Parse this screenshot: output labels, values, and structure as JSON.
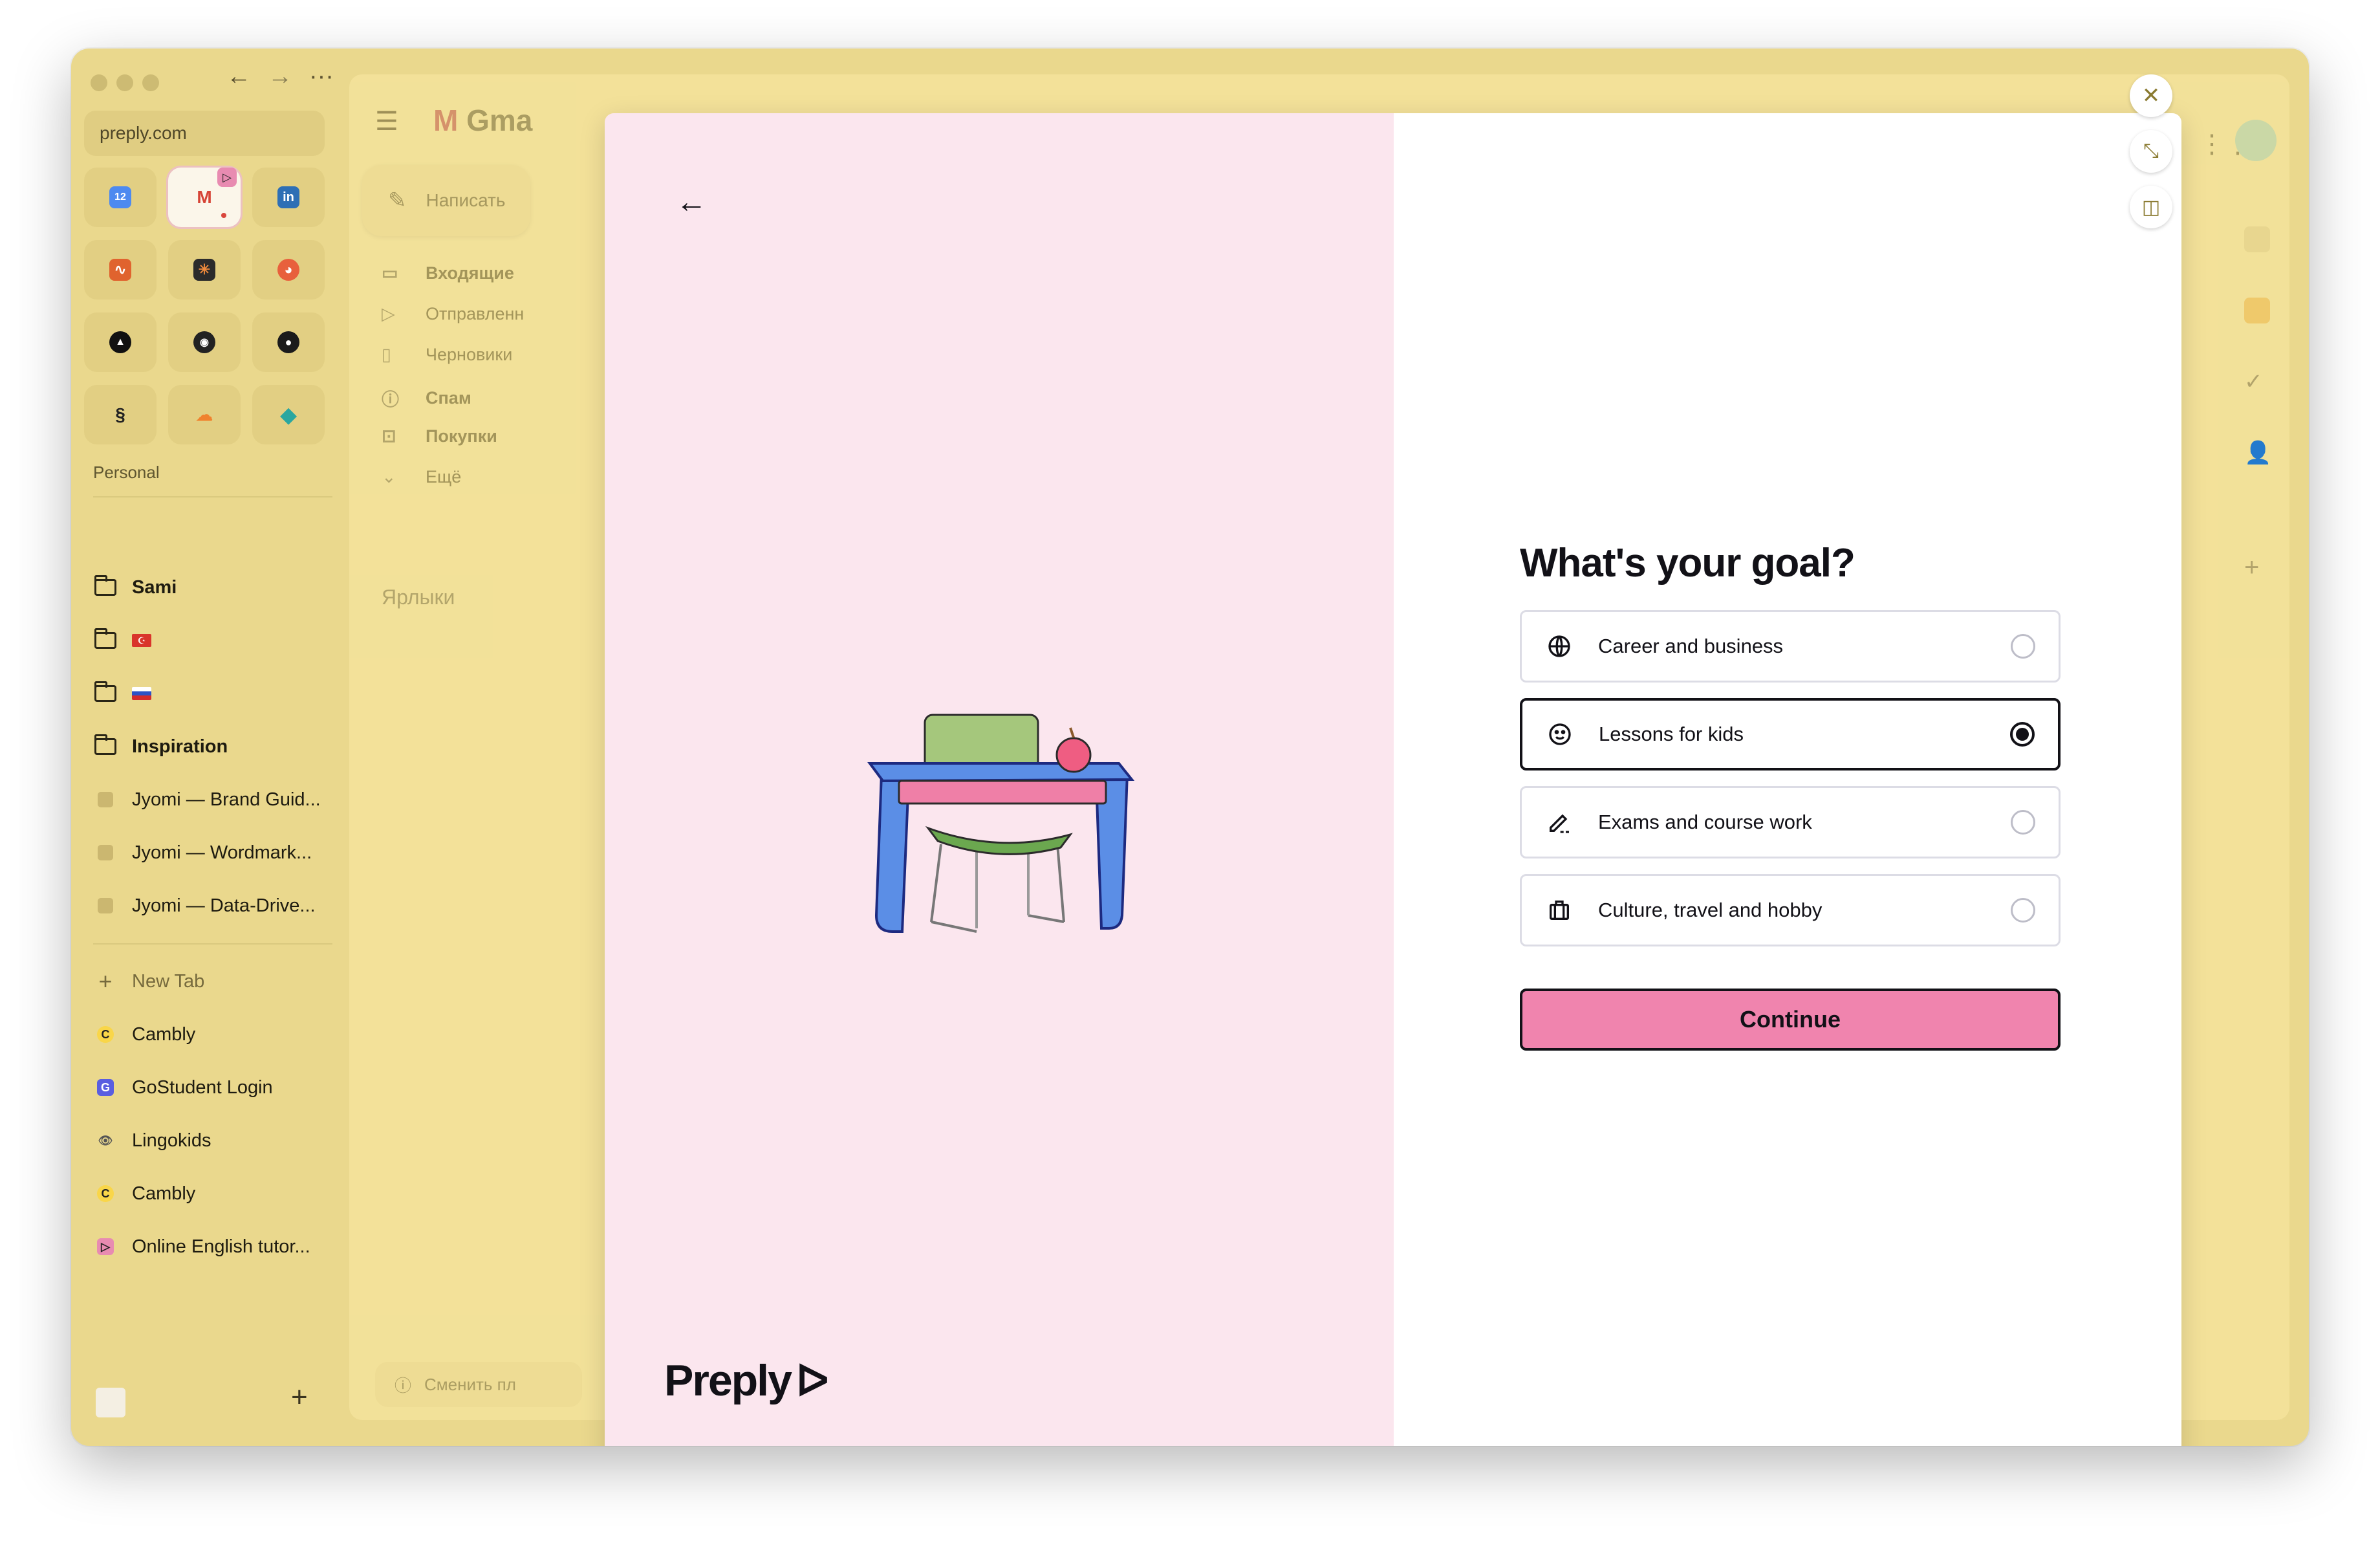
{
  "browser": {
    "url": "preply.com",
    "section_label": "Personal",
    "sidebar_items": [
      {
        "label": "Sami",
        "bold": true
      },
      {
        "label": "",
        "flag": "tr"
      },
      {
        "label": "",
        "flag": "ru"
      },
      {
        "label": "Inspiration",
        "bold": true
      },
      {
        "label": "Jyomi — Brand Guid..."
      },
      {
        "label": "Jyomi — Wordmark..."
      },
      {
        "label": "Jyomi — Data-Drive..."
      }
    ],
    "new_tab": "New Tab",
    "tabs": [
      {
        "label": "Cambly"
      },
      {
        "label": "GoStudent Login"
      },
      {
        "label": "Lingokids"
      },
      {
        "label": "Cambly"
      },
      {
        "label": "Online English tutor..."
      }
    ],
    "turkey_flag_glyph": "☪"
  },
  "gmail": {
    "logo_text": "Gma",
    "compose": "Написать",
    "folders": [
      {
        "label": "Входящие",
        "bold": true,
        "icon": "inbox-icon"
      },
      {
        "label": "Отправленн",
        "bold": false,
        "icon": "send-icon"
      },
      {
        "label": "Черновики",
        "bold": false,
        "icon": "draft-icon"
      },
      {
        "label": "Спам",
        "bold": true,
        "icon": "spam-icon"
      },
      {
        "label": "Покупки",
        "bold": true,
        "icon": "bag-icon"
      },
      {
        "label": "Ещё",
        "bold": false,
        "icon": "chevron-down-icon"
      }
    ],
    "labels_heading": "Ярлыки",
    "bottom_text": "Сменить пл"
  },
  "modal": {
    "title": "What's your goal?",
    "options": [
      {
        "label": "Career and business",
        "icon": "globe-icon",
        "selected": false
      },
      {
        "label": "Lessons for kids",
        "icon": "smiley-icon",
        "selected": true
      },
      {
        "label": "Exams and course work",
        "icon": "pen-icon",
        "selected": false
      },
      {
        "label": "Culture, travel and hobby",
        "icon": "luggage-icon",
        "selected": false
      }
    ],
    "continue_label": "Continue",
    "brand": "Preply",
    "accent": "#f084ae",
    "left_bg": "#fbe6ee"
  }
}
